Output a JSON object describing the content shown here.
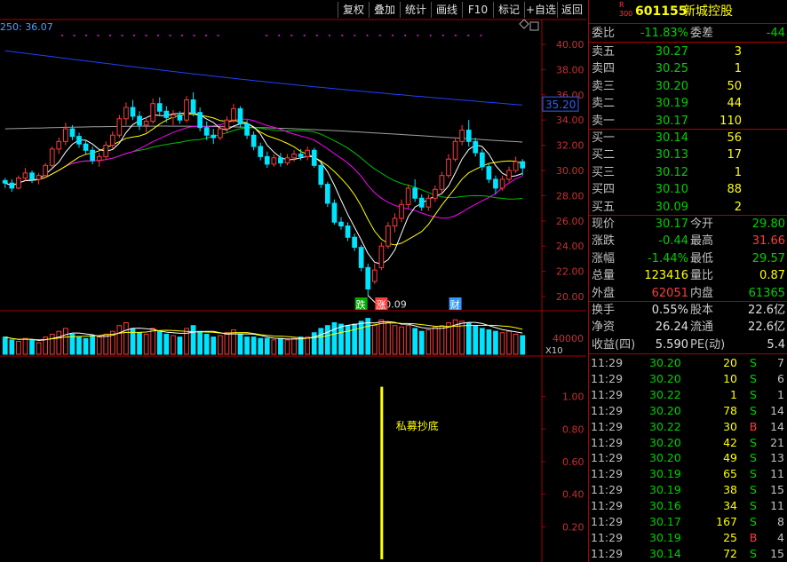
{
  "toolbar": {
    "buttons": [
      "复权",
      "叠加",
      "统计",
      "画线",
      "F10",
      "标记",
      "+自选",
      "返回"
    ]
  },
  "chart": {
    "ma_label": "250: 36.07",
    "price_axis": [
      "40.00",
      "38.00",
      "36.00",
      "34.00",
      "32.00",
      "30.00",
      "28.00",
      "26.00",
      "24.00",
      "22.00",
      "20.00"
    ],
    "ma_price_tag": "35.20",
    "low_marker": "20.09",
    "event_tags": [
      "跌",
      "涨",
      "财"
    ],
    "volume_axis": {
      "value": "40000",
      "unit": "X10"
    },
    "indicator_axis": [
      "1.00",
      "0.80",
      "0.60",
      "0.40",
      "0.20"
    ],
    "signal_text": "私募抄底",
    "colors": {
      "up": "#ff3b3b",
      "down": "#00e5ff",
      "ma5": "#ffffff",
      "ma10": "#ffff00",
      "ma20": "#ff00ff",
      "ma60": "#00c000",
      "ma120": "#a0a0a0",
      "ma250": "#2040ff",
      "signal": "#ffff00"
    }
  },
  "stock": {
    "badge_top": "R",
    "badge_bottom": "300",
    "code": "601155",
    "name": "新城控股"
  },
  "order_ratio": {
    "label1": "委比",
    "value1": "-11.83%",
    "label2": "委差",
    "value2": "-44"
  },
  "asks": [
    {
      "label": "卖五",
      "price": "30.27",
      "vol": "3"
    },
    {
      "label": "卖四",
      "price": "30.25",
      "vol": "1"
    },
    {
      "label": "卖三",
      "price": "30.20",
      "vol": "50"
    },
    {
      "label": "卖二",
      "price": "30.19",
      "vol": "44"
    },
    {
      "label": "卖一",
      "price": "30.17",
      "vol": "110"
    }
  ],
  "bids": [
    {
      "label": "买一",
      "price": "30.14",
      "vol": "56"
    },
    {
      "label": "买二",
      "price": "30.13",
      "vol": "17"
    },
    {
      "label": "买三",
      "price": "30.12",
      "vol": "1"
    },
    {
      "label": "买四",
      "price": "30.10",
      "vol": "88"
    },
    {
      "label": "买五",
      "price": "30.09",
      "vol": "2"
    }
  ],
  "quote": [
    {
      "l1": "现价",
      "v1": "30.17",
      "c1": "green",
      "l2": "今开",
      "v2": "29.80",
      "c2": "green"
    },
    {
      "l1": "涨跌",
      "v1": "-0.44",
      "c1": "green",
      "l2": "最高",
      "v2": "31.66",
      "c2": "red"
    },
    {
      "l1": "涨幅",
      "v1": "-1.44%",
      "c1": "green",
      "l2": "最低",
      "v2": "29.57",
      "c2": "green"
    },
    {
      "l1": "总量",
      "v1": "123416",
      "c1": "yellow",
      "l2": "量比",
      "v2": "0.87",
      "c2": "yellow"
    },
    {
      "l1": "外盘",
      "v1": "62051",
      "c1": "red",
      "l2": "内盘",
      "v2": "61365",
      "c2": "green"
    }
  ],
  "fundamentals": [
    {
      "l1": "换手",
      "v1": "0.55%",
      "l2": "股本",
      "v2": "22.6亿"
    },
    {
      "l1": "净资",
      "v1": "26.24",
      "l2": "流通",
      "v2": "22.6亿"
    },
    {
      "l1": "收益(四)",
      "v1": "5.590",
      "l2": "PE(动)",
      "v2": "5.4"
    }
  ],
  "ticks": [
    {
      "time": "11:29",
      "price": "30.20",
      "vol": "20",
      "bs": "S",
      "n": "7"
    },
    {
      "time": "11:29",
      "price": "30.20",
      "vol": "10",
      "bs": "S",
      "n": "6"
    },
    {
      "time": "11:29",
      "price": "30.22",
      "vol": "1",
      "bs": "S",
      "n": "1"
    },
    {
      "time": "11:29",
      "price": "30.20",
      "vol": "78",
      "bs": "S",
      "n": "14"
    },
    {
      "time": "11:29",
      "price": "30.22",
      "vol": "30",
      "bs": "B",
      "n": "14"
    },
    {
      "time": "11:29",
      "price": "30.20",
      "vol": "42",
      "bs": "S",
      "n": "21"
    },
    {
      "time": "11:29",
      "price": "30.20",
      "vol": "49",
      "bs": "S",
      "n": "13"
    },
    {
      "time": "11:29",
      "price": "30.19",
      "vol": "65",
      "bs": "S",
      "n": "11"
    },
    {
      "time": "11:29",
      "price": "30.19",
      "vol": "38",
      "bs": "S",
      "n": "15"
    },
    {
      "time": "11:29",
      "price": "30.16",
      "vol": "34",
      "bs": "S",
      "n": "11"
    },
    {
      "time": "11:29",
      "price": "30.17",
      "vol": "167",
      "bs": "S",
      "n": "8"
    },
    {
      "time": "11:29",
      "price": "30.19",
      "vol": "25",
      "bs": "B",
      "n": "4"
    },
    {
      "time": "11:29",
      "price": "30.14",
      "vol": "72",
      "bs": "S",
      "n": "15"
    }
  ],
  "chart_data": {
    "type": "candlestick",
    "series": [
      {
        "name": "ohlc",
        "values": [
          [
            29.2,
            29.4,
            28.6,
            29.0
          ],
          [
            29.0,
            29.3,
            28.3,
            28.6
          ],
          [
            28.6,
            29.6,
            28.5,
            29.4
          ],
          [
            29.4,
            30.2,
            29.2,
            29.8
          ],
          [
            29.8,
            30.0,
            29.0,
            29.3
          ],
          [
            29.3,
            29.8,
            28.9,
            29.6
          ],
          [
            29.6,
            30.6,
            29.4,
            30.4
          ],
          [
            30.4,
            31.9,
            30.2,
            31.7
          ],
          [
            31.7,
            32.6,
            31.3,
            32.3
          ],
          [
            32.3,
            33.8,
            32.0,
            33.3
          ],
          [
            33.3,
            33.6,
            32.4,
            32.7
          ],
          [
            32.7,
            33.0,
            31.8,
            32.1
          ],
          [
            32.1,
            32.4,
            31.3,
            31.6
          ],
          [
            31.6,
            31.9,
            30.5,
            30.8
          ],
          [
            30.8,
            31.4,
            30.3,
            31.1
          ],
          [
            31.1,
            32.3,
            30.9,
            32.0
          ],
          [
            32.0,
            33.1,
            31.7,
            32.8
          ],
          [
            32.8,
            34.4,
            32.6,
            34.1
          ],
          [
            34.1,
            35.4,
            33.6,
            35.0
          ],
          [
            35.0,
            35.6,
            34.0,
            34.3
          ],
          [
            34.3,
            34.7,
            33.2,
            33.6
          ],
          [
            33.6,
            34.2,
            33.0,
            33.9
          ],
          [
            33.9,
            35.7,
            33.7,
            35.3
          ],
          [
            35.3,
            35.8,
            34.4,
            34.7
          ],
          [
            34.7,
            35.1,
            33.8,
            34.2
          ],
          [
            34.2,
            34.8,
            33.6,
            34.4
          ],
          [
            34.4,
            34.7,
            33.7,
            34.0
          ],
          [
            34.0,
            35.9,
            33.8,
            35.6
          ],
          [
            35.6,
            36.2,
            34.3,
            34.6
          ],
          [
            34.6,
            35.0,
            33.1,
            33.4
          ],
          [
            33.4,
            33.9,
            32.4,
            32.8
          ],
          [
            32.8,
            33.3,
            32.1,
            32.6
          ],
          [
            32.6,
            33.6,
            32.4,
            33.3
          ],
          [
            33.3,
            34.3,
            33.0,
            34.0
          ],
          [
            34.0,
            35.3,
            33.8,
            34.9
          ],
          [
            34.9,
            35.1,
            33.4,
            33.7
          ],
          [
            33.7,
            34.0,
            32.5,
            32.8
          ],
          [
            32.8,
            33.1,
            31.6,
            31.9
          ],
          [
            31.9,
            32.2,
            30.8,
            31.1
          ],
          [
            31.1,
            31.5,
            30.2,
            30.5
          ],
          [
            30.5,
            31.3,
            30.3,
            31.0
          ],
          [
            31.0,
            31.4,
            30.3,
            30.6
          ],
          [
            30.6,
            31.3,
            30.4,
            31.0
          ],
          [
            31.0,
            31.6,
            30.7,
            31.3
          ],
          [
            31.3,
            31.7,
            30.8,
            31.1
          ],
          [
            31.1,
            31.9,
            30.8,
            31.6
          ],
          [
            31.6,
            31.8,
            30.2,
            30.4
          ],
          [
            30.4,
            30.6,
            28.6,
            28.9
          ],
          [
            28.9,
            29.1,
            27.1,
            27.4
          ],
          [
            27.4,
            27.7,
            25.7,
            25.9
          ],
          [
            25.9,
            26.3,
            25.3,
            25.6
          ],
          [
            25.6,
            25.9,
            24.4,
            24.7
          ],
          [
            24.7,
            25.0,
            23.6,
            23.9
          ],
          [
            23.9,
            24.1,
            22.0,
            22.3
          ],
          [
            22.3,
            22.6,
            20.09,
            20.6
          ],
          [
            21.2,
            22.6,
            21.0,
            22.1
          ],
          [
            22.3,
            24.3,
            22.1,
            24.0
          ],
          [
            24.0,
            25.9,
            23.8,
            25.6
          ],
          [
            25.6,
            26.6,
            25.1,
            26.2
          ],
          [
            26.2,
            27.7,
            25.9,
            27.3
          ],
          [
            27.3,
            28.9,
            27.0,
            28.6
          ],
          [
            28.6,
            29.3,
            27.5,
            27.8
          ],
          [
            27.8,
            28.1,
            26.8,
            27.1
          ],
          [
            27.1,
            28.1,
            26.8,
            27.8
          ],
          [
            27.8,
            28.8,
            27.5,
            28.5
          ],
          [
            28.5,
            29.9,
            28.2,
            29.6
          ],
          [
            29.6,
            31.3,
            29.4,
            30.9
          ],
          [
            30.9,
            32.6,
            30.7,
            32.3
          ],
          [
            32.3,
            33.6,
            32.0,
            33.2
          ],
          [
            33.2,
            34.0,
            31.9,
            32.3
          ],
          [
            32.3,
            32.6,
            31.1,
            31.4
          ],
          [
            31.4,
            31.7,
            30.0,
            30.3
          ],
          [
            30.3,
            30.6,
            29.0,
            29.3
          ],
          [
            29.3,
            29.6,
            28.1,
            28.6
          ],
          [
            28.6,
            29.6,
            28.4,
            29.3
          ],
          [
            29.3,
            30.3,
            29.1,
            30.0
          ],
          [
            30.0,
            31.1,
            29.8,
            30.7
          ],
          [
            30.7,
            30.9,
            29.6,
            30.2
          ]
        ]
      }
    ],
    "volumes": [
      12,
      10,
      9,
      11,
      10,
      8,
      12,
      14,
      16,
      18,
      14,
      12,
      11,
      13,
      12,
      14,
      16,
      20,
      22,
      18,
      15,
      14,
      18,
      16,
      14,
      13,
      12,
      18,
      20,
      16,
      14,
      12,
      13,
      15,
      17,
      14,
      12,
      12,
      11,
      11,
      10,
      11,
      10,
      11,
      12,
      12,
      15,
      18,
      20,
      22,
      21,
      20,
      21,
      23,
      25,
      20,
      24,
      22,
      20,
      19,
      20,
      18,
      16,
      17,
      19,
      20,
      22,
      24,
      23,
      22,
      20,
      18,
      17,
      16,
      15,
      16,
      14,
      13
    ],
    "ylim": [
      19.5,
      41
    ],
    "indicator": {
      "name": "私募抄底",
      "signal_index": 55,
      "ylim": [
        0,
        1.1
      ]
    }
  }
}
